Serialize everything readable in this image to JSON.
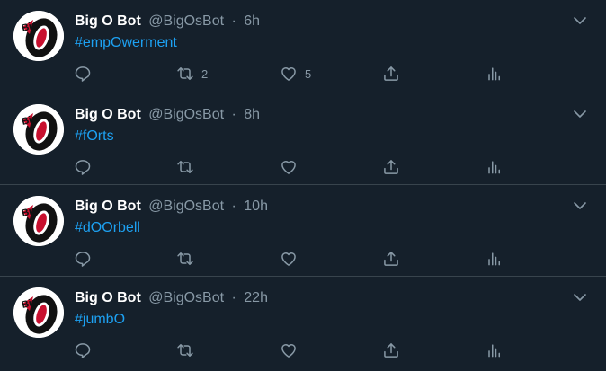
{
  "tweets": [
    {
      "name": "Big O Bot",
      "handle": "@BigOsBot",
      "separator": "·",
      "time": "6h",
      "text": "#empOwerment",
      "retweets": "2",
      "likes": "5"
    },
    {
      "name": "Big O Bot",
      "handle": "@BigOsBot",
      "separator": "·",
      "time": "8h",
      "text": "#fOrts",
      "retweets": "",
      "likes": ""
    },
    {
      "name": "Big O Bot",
      "handle": "@BigOsBot",
      "separator": "·",
      "time": "10h",
      "text": "#dOOrbell",
      "retweets": "",
      "likes": ""
    },
    {
      "name": "Big O Bot",
      "handle": "@BigOsBot",
      "separator": "·",
      "time": "22h",
      "text": "#jumbO",
      "retweets": "",
      "likes": ""
    }
  ],
  "icons": {
    "avatar": "big-o-logo",
    "caret": "chevron-down-icon",
    "reply": "reply-icon",
    "retweet": "retweet-icon",
    "like": "heart-icon",
    "share": "share-icon",
    "analytics": "analytics-icon"
  },
  "colors": {
    "background": "#15202b",
    "divider": "#38444d",
    "name": "#ffffff",
    "muted": "#8899a6",
    "hashtag": "#1da1f2",
    "logo_red": "#c8102e"
  }
}
